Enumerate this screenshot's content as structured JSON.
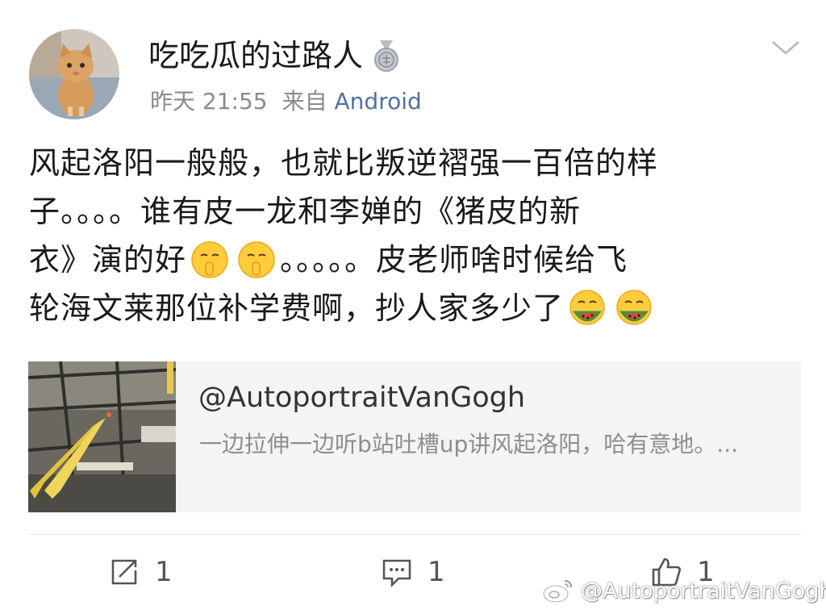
{
  "header": {
    "username": "吃吃瓜的过路人",
    "badge_icon": "medal-icon",
    "time": "昨天 21:55",
    "source_prefix": "来自",
    "source_app": "Android"
  },
  "post": {
    "lines": [
      "风起洛阳一般般，也就比叛逆褶强一百倍的样",
      "子。。。。谁有皮一龙和李婵的《猪皮的新",
      "衣》演的好",
      "。。。。。皮老师啥时候给飞",
      "轮海文莱那位补学费啊，抄人家多少了"
    ],
    "emojis": [
      "shush-emoji",
      "shush-emoji",
      "watermelon-emoji",
      "watermelon-emoji"
    ]
  },
  "repost_card": {
    "handle": "@AutoportraitVanGogh",
    "text": "一边拉伸一边听b站吐槽up讲风起洛阳，哈有意地。..."
  },
  "actions": {
    "repost_count": "1",
    "comment_count": "1",
    "like_count": "1"
  },
  "watermark": {
    "text": "@AutoportraitVanGogh"
  },
  "colors": {
    "link": "#50729c",
    "card_bg": "#f4f4f4",
    "meta_gray": "#8a8a8a"
  }
}
